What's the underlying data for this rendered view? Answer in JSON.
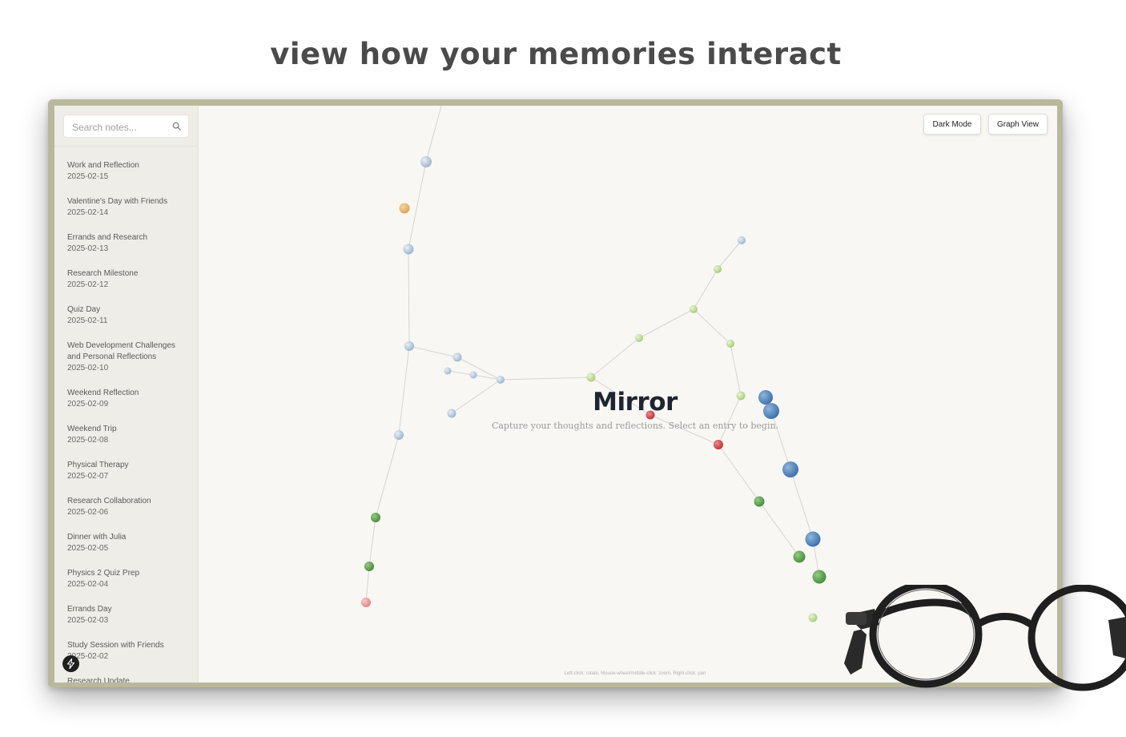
{
  "headline": "view how your memories interact",
  "sidebar": {
    "search": {
      "placeholder": "Search notes..."
    },
    "notes": [
      {
        "title": "Work and Reflection",
        "date": "2025-02-15"
      },
      {
        "title": "Valentine's Day with Friends",
        "date": "2025-02-14"
      },
      {
        "title": "Errands and Research",
        "date": "2025-02-13"
      },
      {
        "title": "Research Milestone",
        "date": "2025-02-12"
      },
      {
        "title": "Quiz Day",
        "date": "2025-02-11"
      },
      {
        "title": "Web Development Challenges and Personal Reflections",
        "date": "2025-02-10"
      },
      {
        "title": "Weekend Reflection",
        "date": "2025-02-09"
      },
      {
        "title": "Weekend Trip",
        "date": "2025-02-08"
      },
      {
        "title": "Physical Therapy",
        "date": "2025-02-07"
      },
      {
        "title": "Research Collaboration",
        "date": "2025-02-06"
      },
      {
        "title": "Dinner with Julia",
        "date": "2025-02-05"
      },
      {
        "title": "Physics 2 Quiz Prep",
        "date": "2025-02-04"
      },
      {
        "title": "Errands Day",
        "date": "2025-02-03"
      },
      {
        "title": "Study Session with Friends",
        "date": "2025-02-02"
      },
      {
        "title": "Research Update",
        "date": ""
      }
    ]
  },
  "toolbar": {
    "dark_mode_label": "Dark Mode",
    "graph_view_label": "Graph View"
  },
  "main": {
    "title": "Mirror",
    "subtitle": "Capture your thoughts and reflections. Select an entry to begin.",
    "controls_hint": "Left-click: rotate, Mouse-wheel/middle-click: zoom, Right-click: pan"
  },
  "colors": {
    "node_blue_light": "#aec3d8",
    "node_blue_dark": "#4f86c0",
    "node_green_light": "#c2dc98",
    "node_green_dark": "#5ea34f",
    "node_red": "#d24b4b",
    "node_orange": "#e8b463",
    "node_pink": "#e7a0a0"
  }
}
